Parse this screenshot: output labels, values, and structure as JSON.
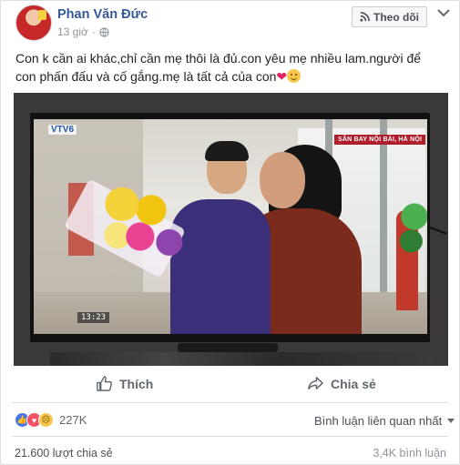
{
  "post": {
    "author": "Phan Văn Đức",
    "timestamp": "13 giờ",
    "privacy_icon": "globe-icon",
    "follow_label": "Theo dõi",
    "follow_icon": "rss-icon",
    "more_icon": "chevron-down-icon",
    "text_line1": "Con k cần ai khác,chỉ cần mẹ thôi là đủ.con yêu mẹ nhiều lam.người để",
    "text_line2": "con phấn đấu và cố gắng.mẹ là tất cả của con",
    "emojis": [
      "heart",
      "smile"
    ]
  },
  "photo": {
    "channel_logo": "VTV6",
    "location_caption": "SÂN BAY NỘI BÀI, HÀ NỘI",
    "clock": "13:23"
  },
  "actions": {
    "like_label": "Thích",
    "share_label": "Chia sẻ"
  },
  "engagement": {
    "reaction_icons": [
      "like",
      "love",
      "sad"
    ],
    "reaction_count": "227K",
    "sort_label": "Bình luận liên quan nhất",
    "shares_text": "21.600 lượt chia sẻ",
    "comments_text": "3,4K bình luận"
  },
  "colors": {
    "author_link": "#365899",
    "like_blue": "#4a76e8",
    "love_red": "#f25268",
    "location_bg": "#b11e2b"
  }
}
